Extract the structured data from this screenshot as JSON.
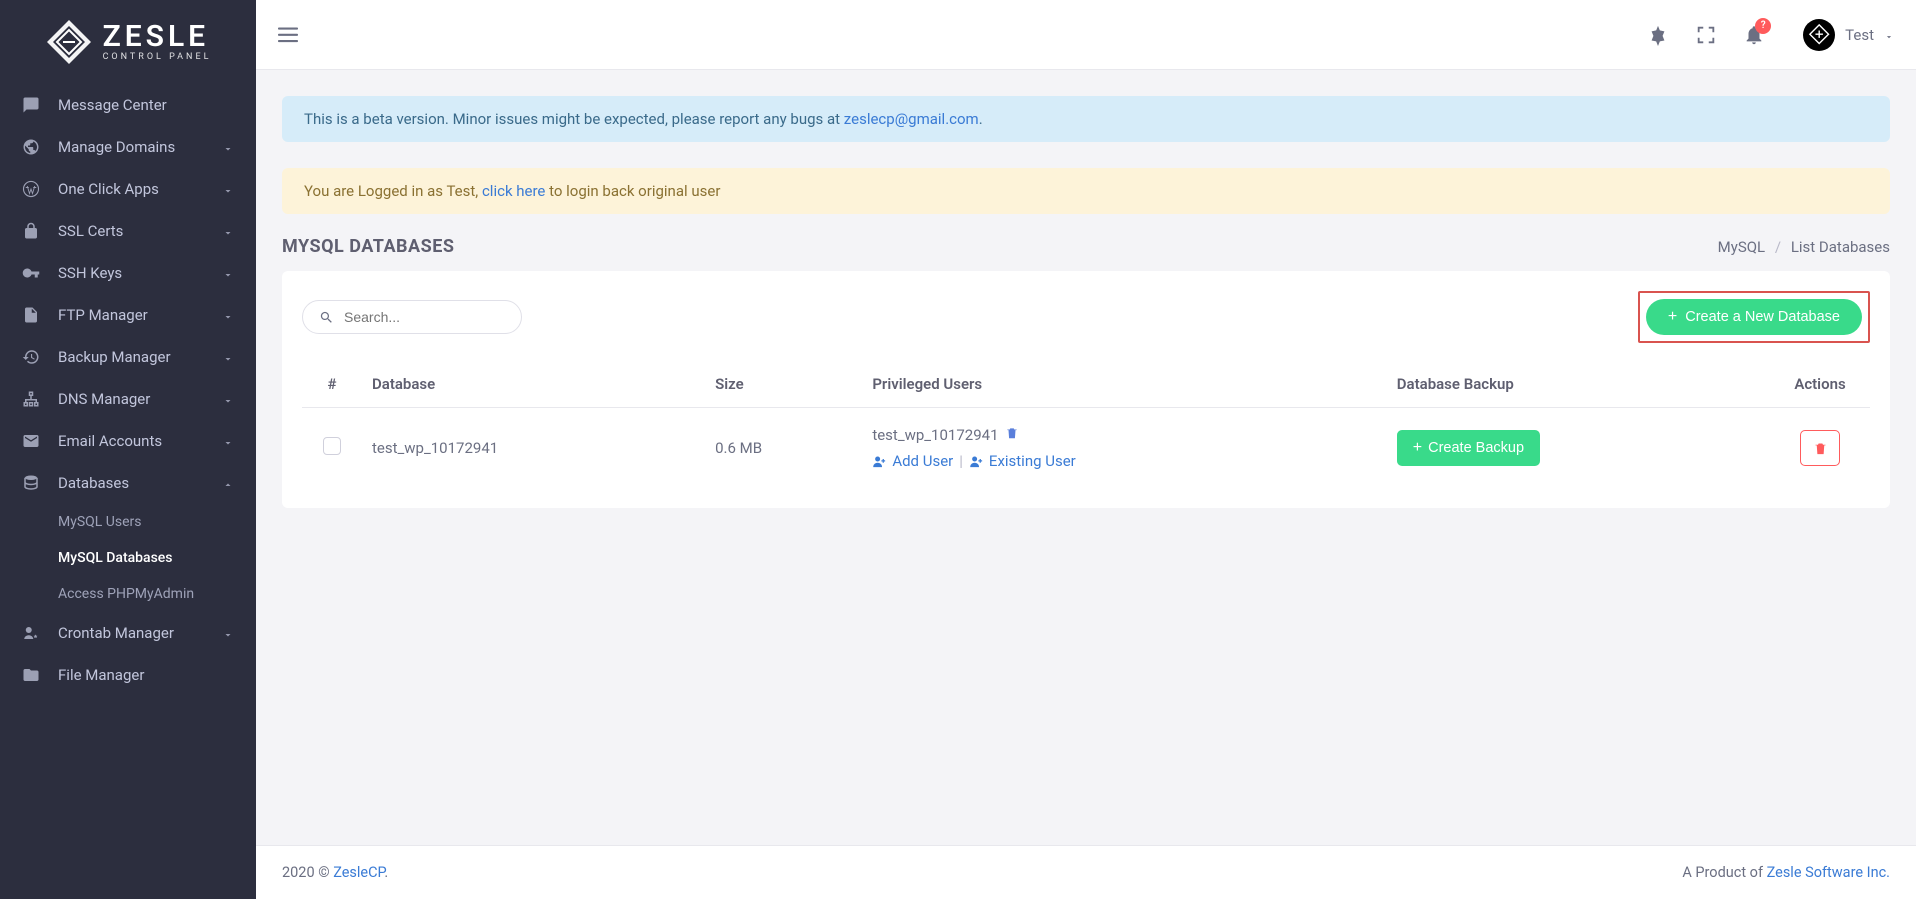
{
  "brand": {
    "name": "ZESLE",
    "subtitle": "CONTROL PANEL"
  },
  "sidebar": {
    "items": [
      {
        "label": "Message Center",
        "expandable": false
      },
      {
        "label": "Manage Domains",
        "expandable": true
      },
      {
        "label": "One Click Apps",
        "expandable": true
      },
      {
        "label": "SSL Certs",
        "expandable": true
      },
      {
        "label": "SSH Keys",
        "expandable": true
      },
      {
        "label": "FTP Manager",
        "expandable": true
      },
      {
        "label": "Backup Manager",
        "expandable": true
      },
      {
        "label": "DNS Manager",
        "expandable": true
      },
      {
        "label": "Email Accounts",
        "expandable": true
      },
      {
        "label": "Databases",
        "expandable": true,
        "open": true
      },
      {
        "label": "Crontab Manager",
        "expandable": true
      },
      {
        "label": "File Manager",
        "expandable": false
      }
    ],
    "databases_sub": [
      {
        "label": "MySQL Users"
      },
      {
        "label": "MySQL Databases",
        "active": true
      },
      {
        "label": "Access PHPMyAdmin"
      }
    ]
  },
  "topbar": {
    "notification_badge": "?",
    "user_name": "Test"
  },
  "alerts": {
    "beta_pre": "This is a beta version. Minor issues might be expected, please report any bugs at ",
    "beta_email": "zeslecp@gmail.com",
    "beta_post": ".",
    "login_pre": "You are Logged in as Test, ",
    "login_link": "click here",
    "login_post": " to login back original user"
  },
  "page": {
    "title": "MYSQL DATABASES",
    "breadcrumb": {
      "root": "MySQL",
      "current": "List Databases"
    }
  },
  "toolbar": {
    "search_placeholder": "Search...",
    "create_label": "Create a New Database"
  },
  "table": {
    "headers": {
      "hash": "#",
      "database": "Database",
      "size": "Size",
      "users": "Privileged Users",
      "backup": "Database Backup",
      "actions": "Actions"
    },
    "row": {
      "database": "test_wp_10172941",
      "size": "0.6 MB",
      "priv_user": "test_wp_10172941",
      "add_user": "Add User",
      "existing_user": "Existing User",
      "create_backup": "Create Backup"
    }
  },
  "footer": {
    "copyright_pre": "2020 © ",
    "copyright_link": "ZesleCP",
    "copyright_post": ".",
    "right_pre": "A Product of ",
    "right_link": "Zesle Software Inc."
  }
}
